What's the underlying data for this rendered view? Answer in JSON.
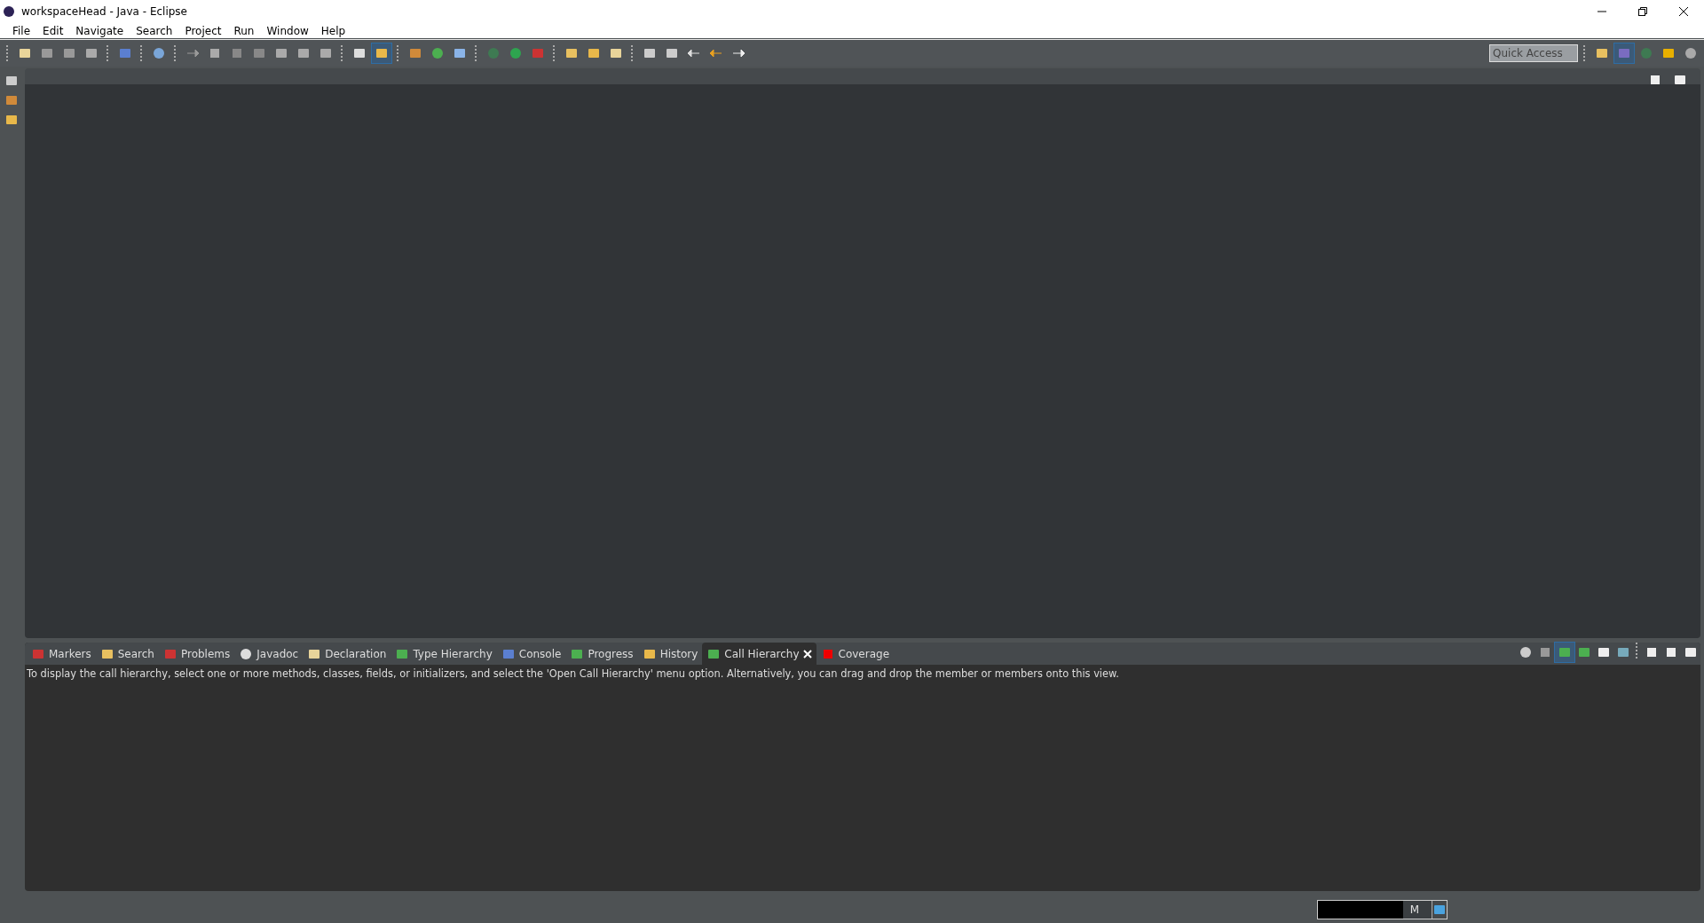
{
  "window": {
    "title": "workspaceHead - Java - Eclipse"
  },
  "menu": [
    {
      "label": "File"
    },
    {
      "label": "Edit"
    },
    {
      "label": "Navigate"
    },
    {
      "label": "Search"
    },
    {
      "label": "Project"
    },
    {
      "label": "Run"
    },
    {
      "label": "Window"
    },
    {
      "label": "Help"
    }
  ],
  "quick_access": {
    "placeholder": "Quick Access"
  },
  "bottom_panel": {
    "tabs": [
      {
        "label": "Markers",
        "selected": false
      },
      {
        "label": "Search",
        "selected": false
      },
      {
        "label": "Problems",
        "selected": false
      },
      {
        "label": "Javadoc",
        "selected": false
      },
      {
        "label": "Declaration",
        "selected": false
      },
      {
        "label": "Type Hierarchy",
        "selected": false
      },
      {
        "label": "Console",
        "selected": false
      },
      {
        "label": "Progress",
        "selected": false
      },
      {
        "label": "History",
        "selected": false
      },
      {
        "label": "Call Hierarchy",
        "selected": true
      },
      {
        "label": "Coverage",
        "selected": false
      }
    ],
    "message": "To display the call hierarchy, select one or more methods, classes, fields, or initializers, and select the 'Open Call Hierarchy' menu option. Alternatively, you can drag and drop the member or members onto this view."
  },
  "status_bar": {
    "heap": {
      "text": "M",
      "level": 0.75
    }
  }
}
